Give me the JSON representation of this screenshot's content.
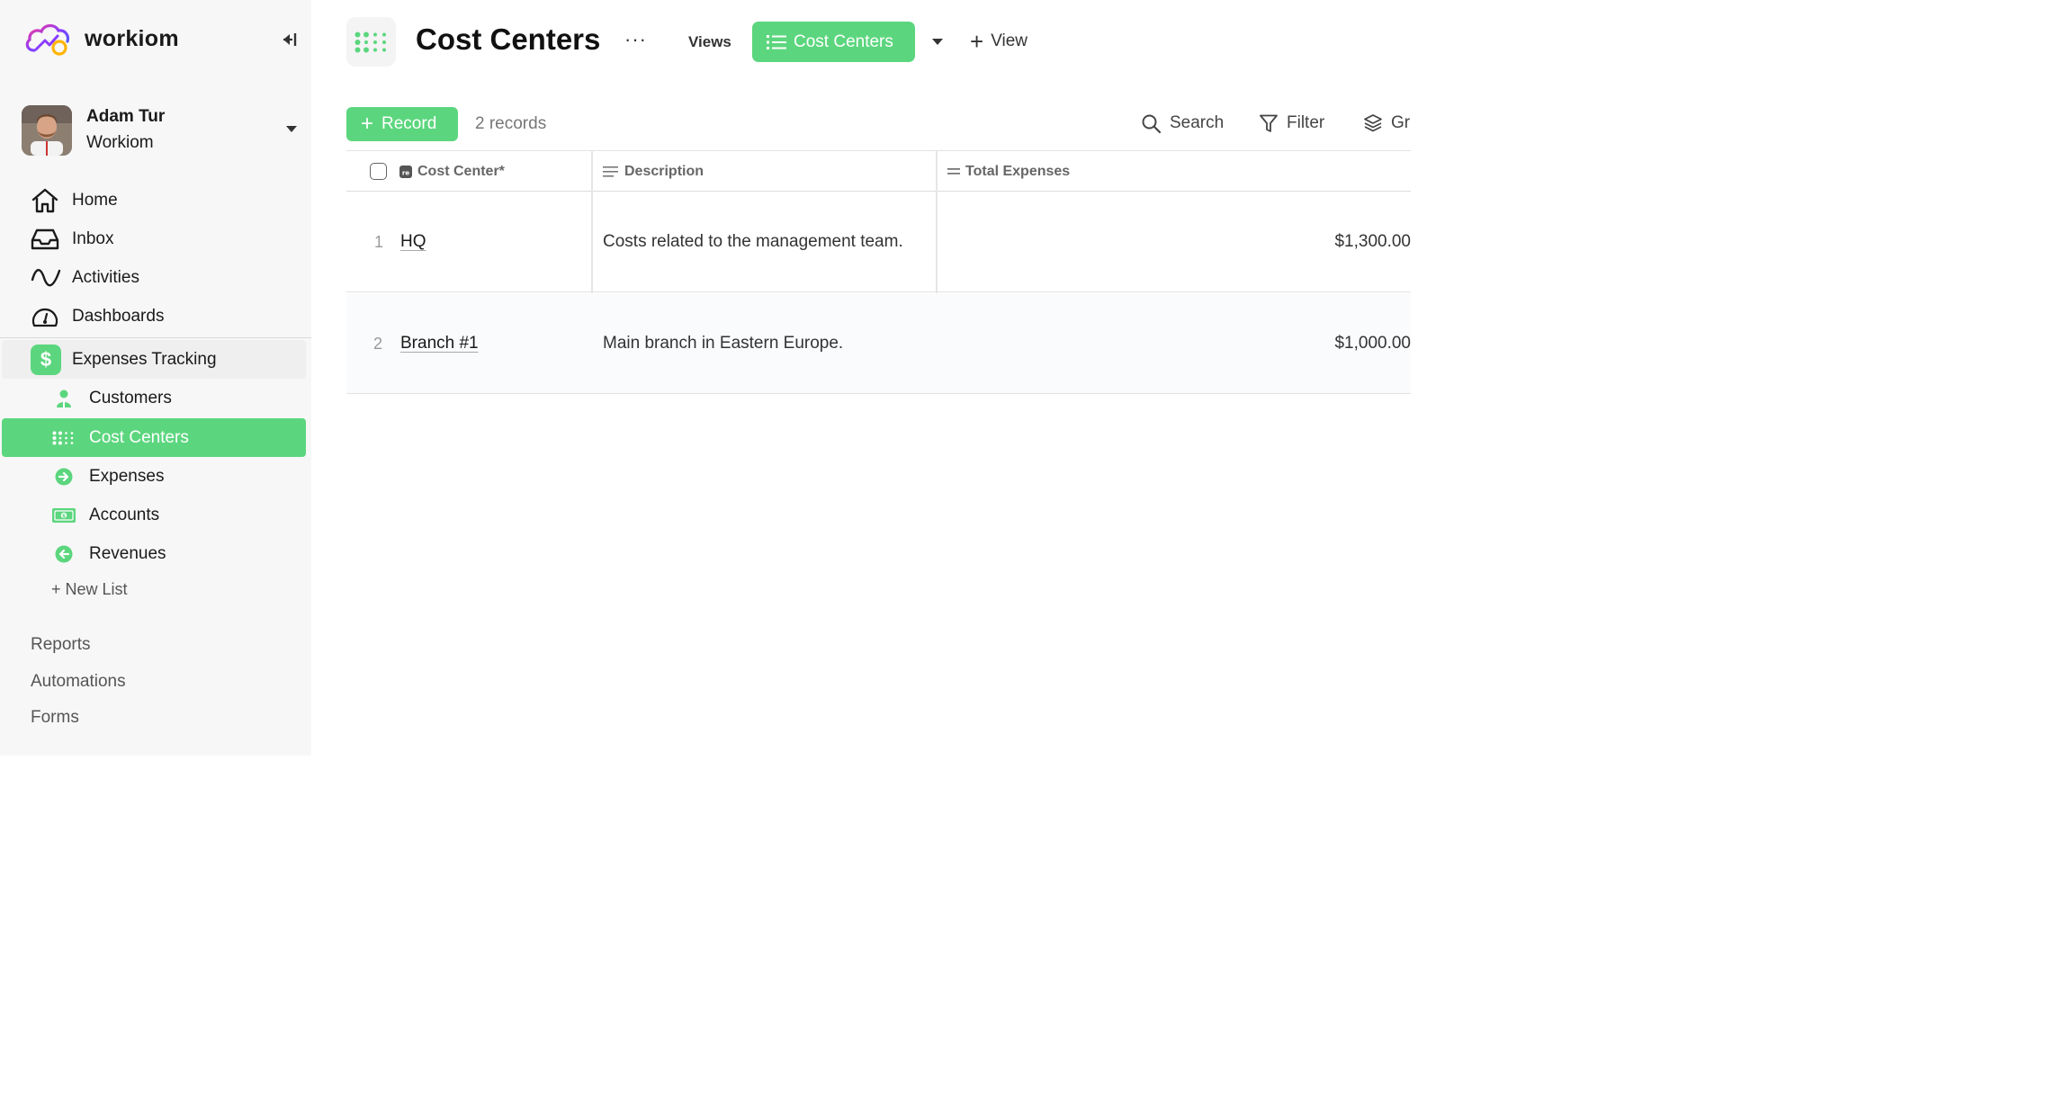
{
  "brand": {
    "name": "workiom"
  },
  "user": {
    "name": "Adam Tur",
    "org": "Workiom"
  },
  "nav": [
    {
      "label": "Home",
      "icon": "home-icon"
    },
    {
      "label": "Inbox",
      "icon": "inbox-icon"
    },
    {
      "label": "Activities",
      "icon": "activity-icon"
    },
    {
      "label": "Dashboards",
      "icon": "dashboard-gauge-icon"
    }
  ],
  "app": {
    "label": "Expenses Tracking",
    "icon_glyph": "$"
  },
  "lists": [
    {
      "label": "Customers",
      "icon": "customer-icon",
      "active": false
    },
    {
      "label": "Cost Centers",
      "icon": "grid-dots-icon",
      "active": true
    },
    {
      "label": "Expenses",
      "icon": "arrow-right-circle-icon",
      "active": false
    },
    {
      "label": "Accounts",
      "icon": "cash-icon",
      "active": false
    },
    {
      "label": "Revenues",
      "icon": "arrow-left-circle-icon",
      "active": false
    }
  ],
  "new_list": "+ New List",
  "footer": {
    "reports": "Reports",
    "automations": "Automations",
    "forms": "Forms"
  },
  "header": {
    "title": "Cost Centers",
    "more": "···",
    "views_label": "Views",
    "current_view": "Cost Centers",
    "add_view": "View"
  },
  "toolbar": {
    "record_label": "Record",
    "record_count": "2 records",
    "search": "Search",
    "filter": "Filter",
    "group": "Gr"
  },
  "table": {
    "columns": [
      {
        "label": "Cost Center*",
        "icon": "text-field-icon"
      },
      {
        "label": "Description",
        "icon": "paragraph-icon"
      },
      {
        "label": "Total Expenses",
        "icon": "formula-equals-icon"
      }
    ],
    "rows": [
      {
        "num": "1",
        "name": "HQ",
        "description": "Costs related to the management team.",
        "total": "$1,300.00"
      },
      {
        "num": "2",
        "name": "Branch #1",
        "description": "Main branch in Eastern Europe.",
        "total": "$1,000.00"
      }
    ]
  },
  "colors": {
    "accent": "#5cd67e",
    "sidebar_bg": "#f7f7f7"
  }
}
